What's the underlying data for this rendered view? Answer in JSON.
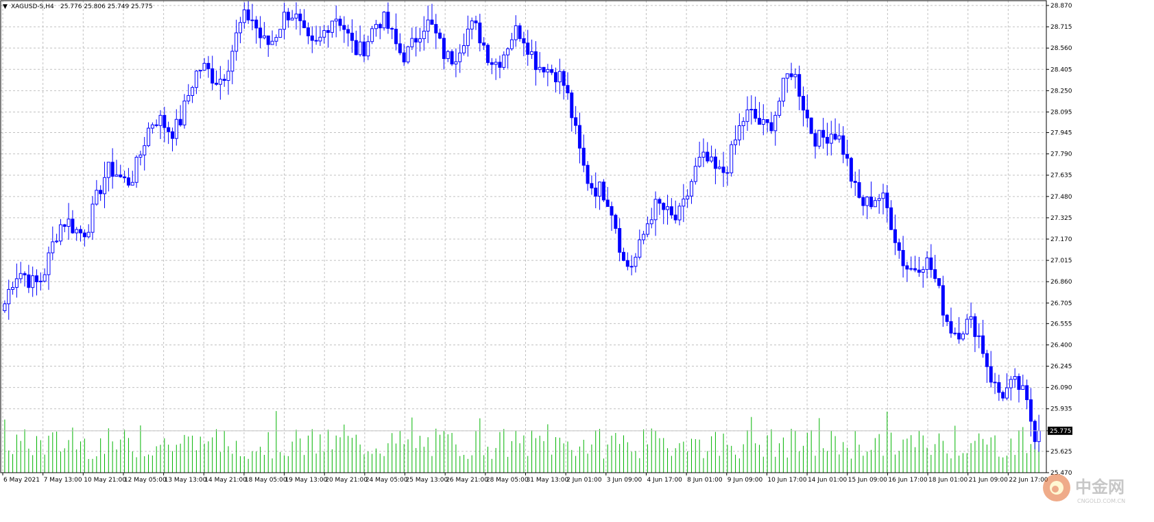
{
  "header": {
    "menu_glyph": "▼",
    "symbol": "XAGUSD-S,H4",
    "ohlc": "25.776 25.806 25.749 25.775"
  },
  "price_tag": "25.775",
  "watermark": {
    "text": "中金网",
    "url": "CNGOLD.COM.CN"
  },
  "colors": {
    "background": "#ffffff",
    "grid": "#c0c0c0",
    "bull": "#0000ff",
    "bear": "#0000ff",
    "volume": "#00b400",
    "last_price_line": "#c0c0c0"
  },
  "chart_data": {
    "type": "candlestick",
    "timeframe": "H4",
    "ylim": [
      25.47,
      28.87
    ],
    "y_ticks": [
      "28.870",
      "28.715",
      "28.560",
      "28.405",
      "28.250",
      "28.095",
      "27.945",
      "27.790",
      "27.635",
      "27.480",
      "27.325",
      "27.170",
      "27.015",
      "26.860",
      "26.705",
      "26.555",
      "26.400",
      "26.245",
      "26.090",
      "25.935",
      "25.775",
      "25.625",
      "25.470"
    ],
    "x_labels": [
      "6 May 2021",
      "7 May 13:00",
      "10 May 21:00",
      "12 May 05:00",
      "13 May 13:00",
      "14 May 21:00",
      "18 May 05:00",
      "19 May 13:00",
      "20 May 21:00",
      "24 May 05:00",
      "25 May 13:00",
      "26 May 21:00",
      "28 May 05:00",
      "31 May 13:00",
      "2 Jun 01:00",
      "3 Jun 09:00",
      "4 Jun 17:00",
      "8 Jun 01:00",
      "9 Jun 09:00",
      "10 Jun 17:00",
      "14 Jun 01:00",
      "15 Jun 09:00",
      "16 Jun 17:00",
      "18 Jun 01:00",
      "21 Jun 09:00",
      "22 Jun 17:00"
    ],
    "last_price": 25.775,
    "key_points": [
      {
        "label": "6 May 2021",
        "price": 26.7
      },
      {
        "label": "18 May 05:00",
        "price": 28.72
      },
      {
        "label": "31 May 13:00",
        "price": 28.55
      },
      {
        "label": "3 Jun 09:00",
        "price": 27.05
      },
      {
        "label": "10 Jun 17:00",
        "price": 28.28
      },
      {
        "label": "16 Jun 17:00",
        "price": 27.0
      },
      {
        "label": "22 Jun 17:00",
        "price": 25.775
      }
    ]
  }
}
